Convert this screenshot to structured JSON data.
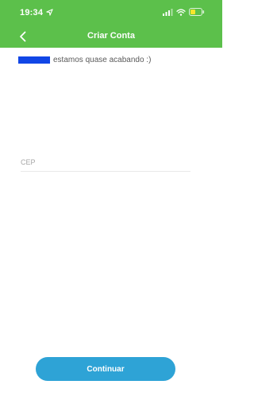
{
  "status_bar": {
    "time": "19:34",
    "icons": [
      "location-arrow-icon",
      "signal-icon",
      "wifi-icon",
      "battery-icon"
    ]
  },
  "header": {
    "title": "Criar Conta",
    "back_icon": "chevron-left-icon",
    "background": "#5cc04b"
  },
  "greeting": {
    "text": "estamos quase acabando :)",
    "redaction_color": "#1146e6"
  },
  "form": {
    "cep": {
      "label": "CEP",
      "value": ""
    }
  },
  "footer": {
    "continue_label": "Continuar",
    "button_color": "#2ea3d6"
  }
}
